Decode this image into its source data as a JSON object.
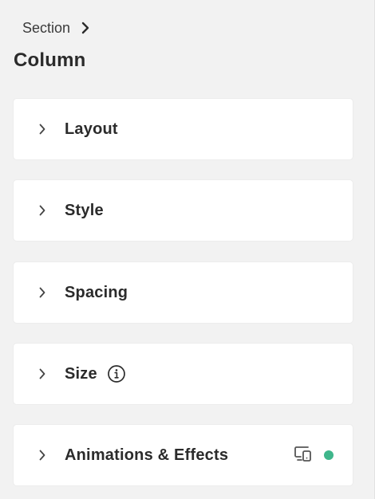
{
  "breadcrumb": {
    "parent_label": "Section"
  },
  "panel": {
    "title": "Column"
  },
  "sections": [
    {
      "label": "Layout"
    },
    {
      "label": "Style"
    },
    {
      "label": "Spacing"
    },
    {
      "label": "Size",
      "icon": "info-icon"
    },
    {
      "label": "Animations & Effects",
      "icons": [
        "responsive-devices-icon"
      ],
      "status_color": "#3fb68b"
    }
  ],
  "colors": {
    "background": "#f2f2f2",
    "card": "#ffffff",
    "text": "#2b2b2b",
    "status_dot": "#3fb68b"
  }
}
